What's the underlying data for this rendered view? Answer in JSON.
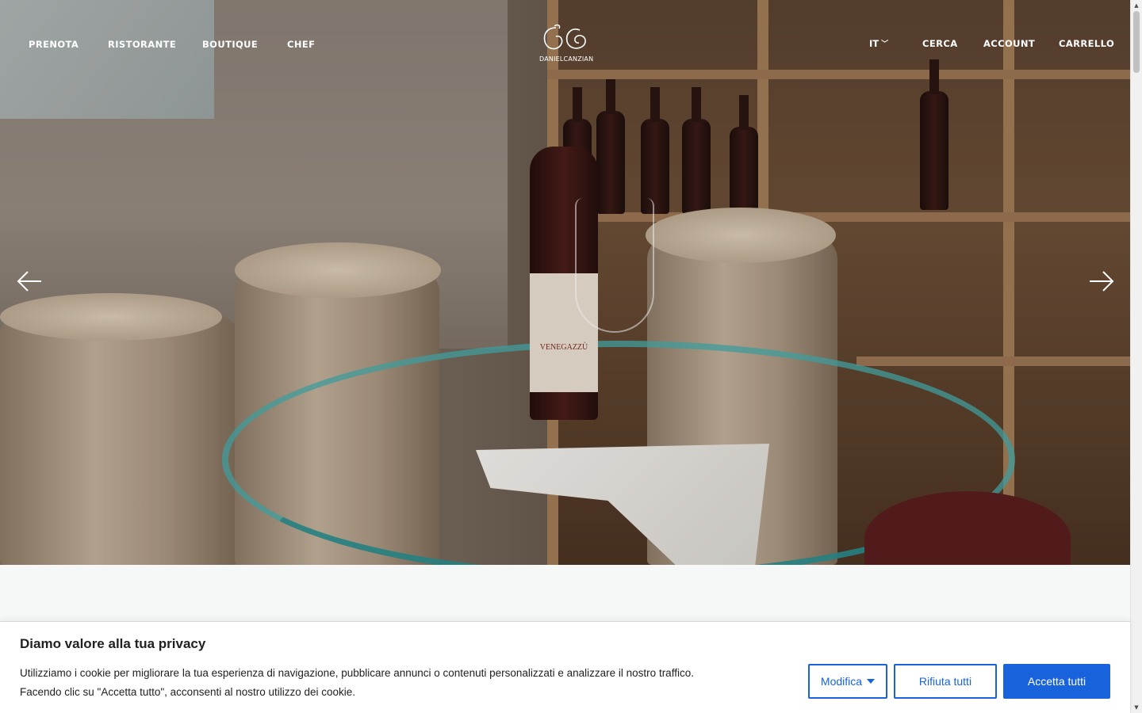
{
  "nav": {
    "left": [
      {
        "label": "PRENOTA"
      },
      {
        "label": "RISTORANTE"
      },
      {
        "label": "BOUTIQUE"
      },
      {
        "label": "CHEF"
      }
    ],
    "logo_text": "DANIELCANZIAN",
    "language": "IT",
    "right": [
      {
        "label": "CERCA"
      },
      {
        "label": "ACCOUNT"
      },
      {
        "label": "CARRELLO"
      }
    ]
  },
  "hero": {
    "wine_label": "VENEGAZZÙ"
  },
  "cookie_banner": {
    "title": "Diamo valore alla tua privacy",
    "text_line1": "Utilizziamo i cookie per migliorare la tua esperienza di navigazione, pubblicare annunci o contenuti personalizzati e analizzare il nostro traffico.",
    "text_line2": "Facendo clic su \"Accetta tutto\", acconsenti al nostro utilizzo dei cookie.",
    "customize_label": "Modifica",
    "reject_label": "Rifiuta tutti",
    "accept_label": "Accetta tutti",
    "accent_color": "#1863dc"
  }
}
